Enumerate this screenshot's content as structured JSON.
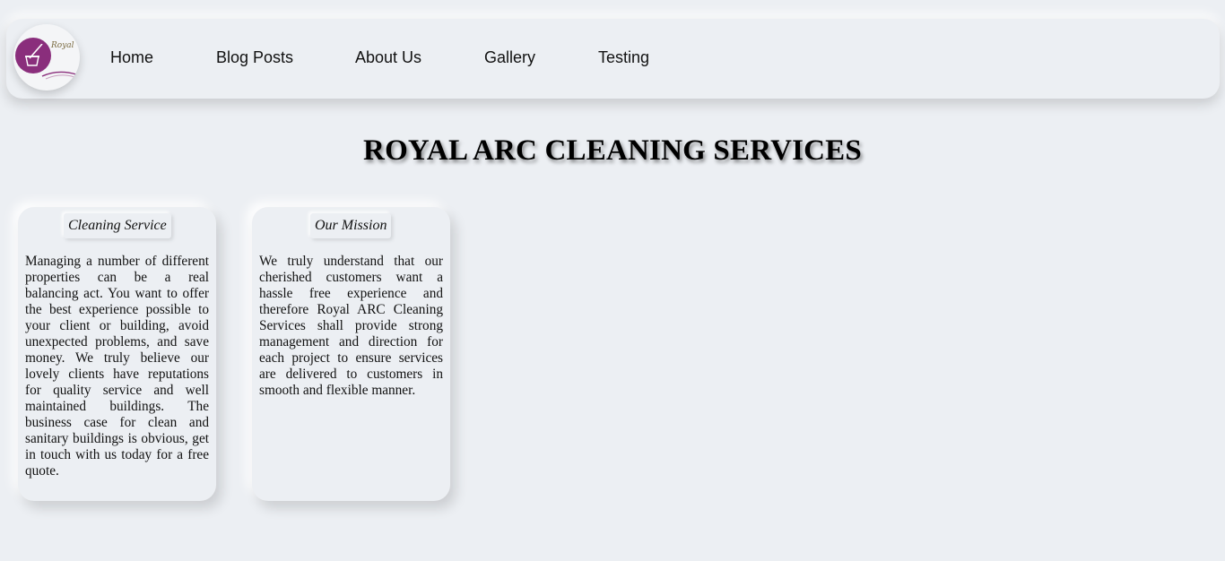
{
  "nav": {
    "logo_text": "Royal",
    "links": [
      "Home",
      "Blog Posts",
      "About Us",
      "Gallery",
      "Testing"
    ]
  },
  "main": {
    "title": "ROYAL ARC CLEANING SERVICES",
    "cards": [
      {
        "heading": "Cleaning Service",
        "body": "Managing a number of different properties can be a real balancing act. You want to offer the best experience possible to your client or building, avoid unexpected problems, and save money. We truly believe our lovely clients have reputations for quality service and well maintained buildings. The business case for clean and sanitary buildings is obvious, get in touch with us today for a free quote."
      },
      {
        "heading": "Our Mission",
        "body": "We truly understand that our cherished customers want a hassle free experience and therefore Royal ARC Cleaning Services shall provide strong management and direction for each project to ensure services are delivered to customers in smooth and flexible manner."
      }
    ]
  },
  "colors": {
    "background": "#eceff3",
    "logo_accent": "#8a2e7c"
  }
}
